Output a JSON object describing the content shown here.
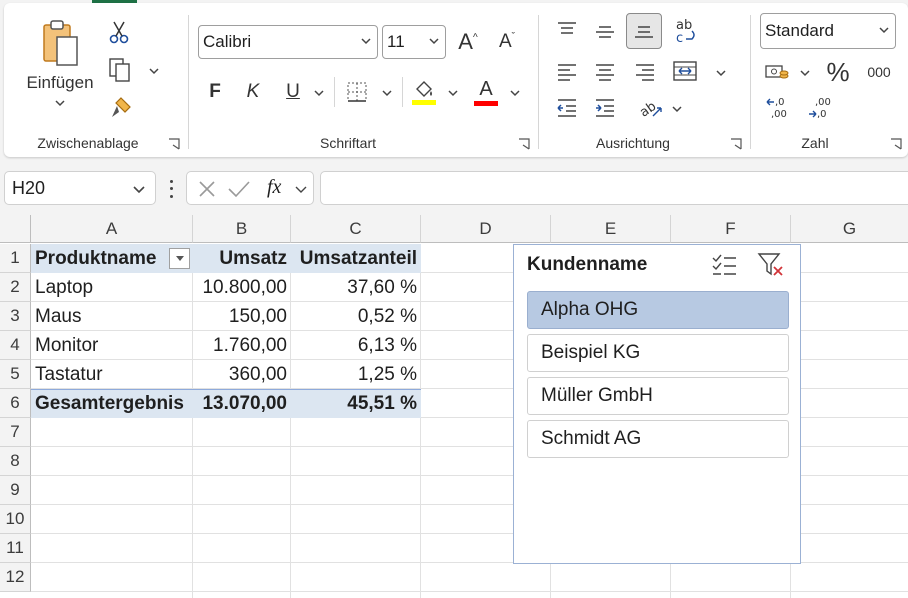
{
  "ribbon": {
    "clipboard": {
      "paste_label": "Einfügen",
      "group_label": "Zwischenablage"
    },
    "font": {
      "name": "Calibri",
      "size": "11",
      "bold": "F",
      "italic": "K",
      "underline": "U",
      "group_label": "Schriftart",
      "fill_color": "#ffff00",
      "font_color": "#ff0000"
    },
    "alignment": {
      "group_label": "Ausrichtung"
    },
    "number": {
      "format": "Standard",
      "percent": "%",
      "thousands": "000",
      "group_label": "Zahl"
    }
  },
  "formula_bar": {
    "name_box": "H20",
    "fx": "fx",
    "value": ""
  },
  "columns": [
    "A",
    "B",
    "C",
    "D",
    "E",
    "F",
    "G"
  ],
  "rows": [
    "1",
    "2",
    "3",
    "4",
    "5",
    "6",
    "7",
    "8",
    "9",
    "10",
    "11",
    "12"
  ],
  "pivot": {
    "headers": [
      "Produktname",
      "Umsatz",
      "Umsatzanteil"
    ],
    "rows": [
      [
        "Laptop",
        "10.800,00",
        "37,60 %"
      ],
      [
        "Maus",
        "150,00",
        "0,52 %"
      ],
      [
        "Monitor",
        "1.760,00",
        "6,13 %"
      ],
      [
        "Tastatur",
        "360,00",
        "1,25 %"
      ]
    ],
    "total": [
      "Gesamtergebnis",
      "13.070,00",
      "45,51 %"
    ]
  },
  "slicer": {
    "title": "Kundenname",
    "items": [
      {
        "label": "Alpha OHG",
        "selected": true
      },
      {
        "label": "Beispiel KG",
        "selected": false
      },
      {
        "label": "Müller GmbH",
        "selected": false
      },
      {
        "label": "Schmidt AG",
        "selected": false
      }
    ]
  }
}
